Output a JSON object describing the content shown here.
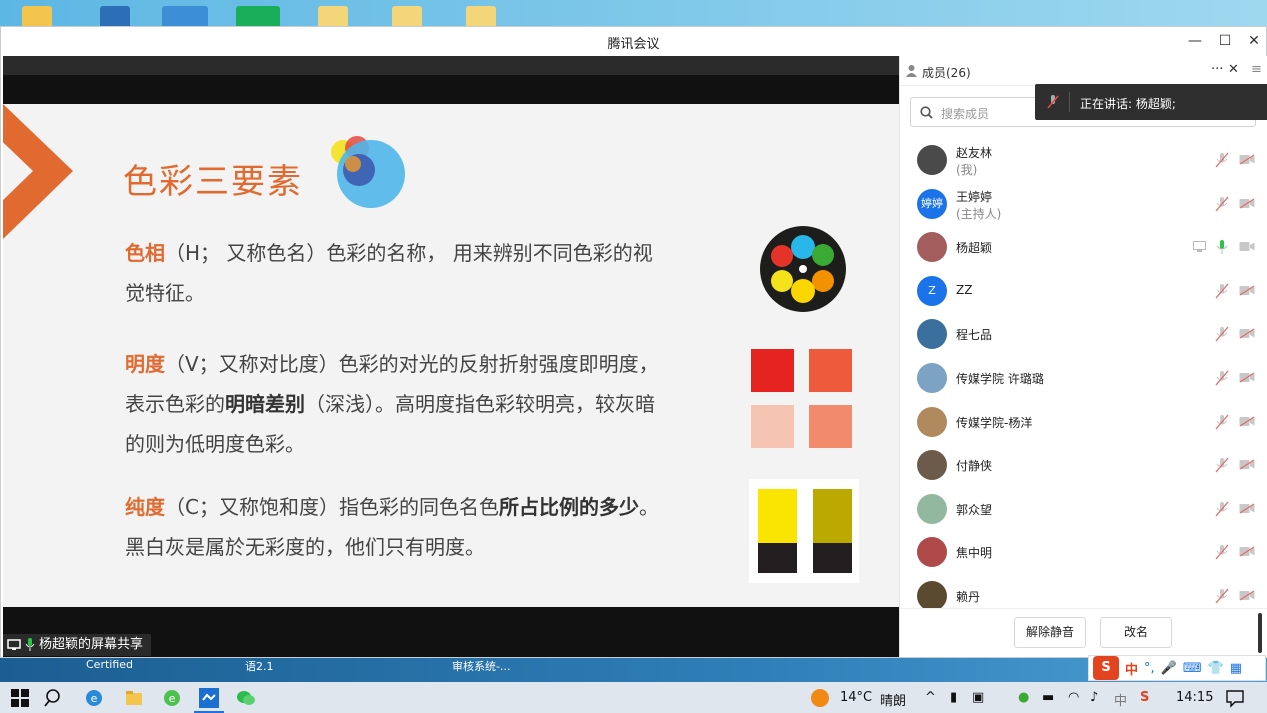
{
  "window": {
    "title": "腾讯会议",
    "minimize_glyph": "—",
    "maximize_glyph": "☐",
    "close_glyph": "✕"
  },
  "slide": {
    "title": "色彩三要素",
    "p1_term": "色相",
    "p1_text": "（H； 又称色名）色彩的名称， 用来辨别不同色彩的视觉特征。",
    "p2_term": "明度",
    "p2_text_a": "（V；又称对比度）色彩的对光的反射折射强度即明度， 表示色彩的",
    "p2_bold": "明暗差别",
    "p2_text_b": "（深浅）。高明度指色彩较明亮，较灰暗的则为低明度色彩。",
    "p3_term": "纯度",
    "p3_text_a": "（C；又称饱和度）指色彩的同色名色",
    "p3_bold": "所占比例的多少",
    "p3_text_b": "。黑白灰是属於无彩度的，他们只有明度。",
    "colors": {
      "accent": "#e06a2f",
      "sq1": "#e52421",
      "sq2": "#ee5a3c",
      "sq3": "#f6c4b2",
      "sq4": "#f18b6b",
      "yellow1": "#f9e500",
      "yellow2": "#bca900",
      "dark": "#231f20"
    }
  },
  "share": {
    "sharer_label": "杨超颖的屏幕共享"
  },
  "panel": {
    "title": "成员(26)",
    "more_glyph": "···",
    "close_glyph": "✕",
    "search_placeholder": "搜索成员",
    "speaking_label": "正在讲话: 杨超颖;",
    "members": [
      {
        "name": "赵友林",
        "role": "(我)",
        "avatar_color": "#4a4a4a",
        "avatar_text": "",
        "mic": "muted"
      },
      {
        "name": "王婷婷",
        "role": "(主持人)",
        "avatar_color": "#1a73e8",
        "avatar_text": "婷婷",
        "mic": "muted"
      },
      {
        "name": "杨超颖",
        "role": "",
        "avatar_color": "#a35d5d",
        "avatar_text": "",
        "mic": "active",
        "sharing": true
      },
      {
        "name": "ZZ",
        "role": "",
        "avatar_color": "#1a73e8",
        "avatar_text": "Z",
        "mic": "muted"
      },
      {
        "name": "程七品",
        "role": "",
        "avatar_color": "#3a6f9e",
        "avatar_text": "",
        "mic": "muted"
      },
      {
        "name": "传媒学院 许璐璐",
        "role": "",
        "avatar_color": "#7ca3c4",
        "avatar_text": "",
        "mic": "muted"
      },
      {
        "name": "传媒学院-杨洋",
        "role": "",
        "avatar_color": "#b08a5c",
        "avatar_text": "",
        "mic": "muted"
      },
      {
        "name": "付静侠",
        "role": "",
        "avatar_color": "#6c5a4a",
        "avatar_text": "",
        "mic": "muted"
      },
      {
        "name": "郭众望",
        "role": "",
        "avatar_color": "#93b8a0",
        "avatar_text": "",
        "mic": "muted"
      },
      {
        "name": "焦中明",
        "role": "",
        "avatar_color": "#b04a4a",
        "avatar_text": "",
        "mic": "muted"
      },
      {
        "name": "赖丹",
        "role": "",
        "avatar_color": "#5a4a30",
        "avatar_text": "",
        "mic": "muted"
      }
    ],
    "unmute_button": "解除静音",
    "rename_button": "改名"
  },
  "desktop": {
    "behind_texts": [
      "Certified",
      "语2.1",
      "审核系统-..."
    ]
  },
  "ime": {
    "lang": "中",
    "punct": "°,"
  },
  "taskbar": {
    "weather_temp": "14°C",
    "weather_text": "晴朗",
    "time": "14:15"
  }
}
